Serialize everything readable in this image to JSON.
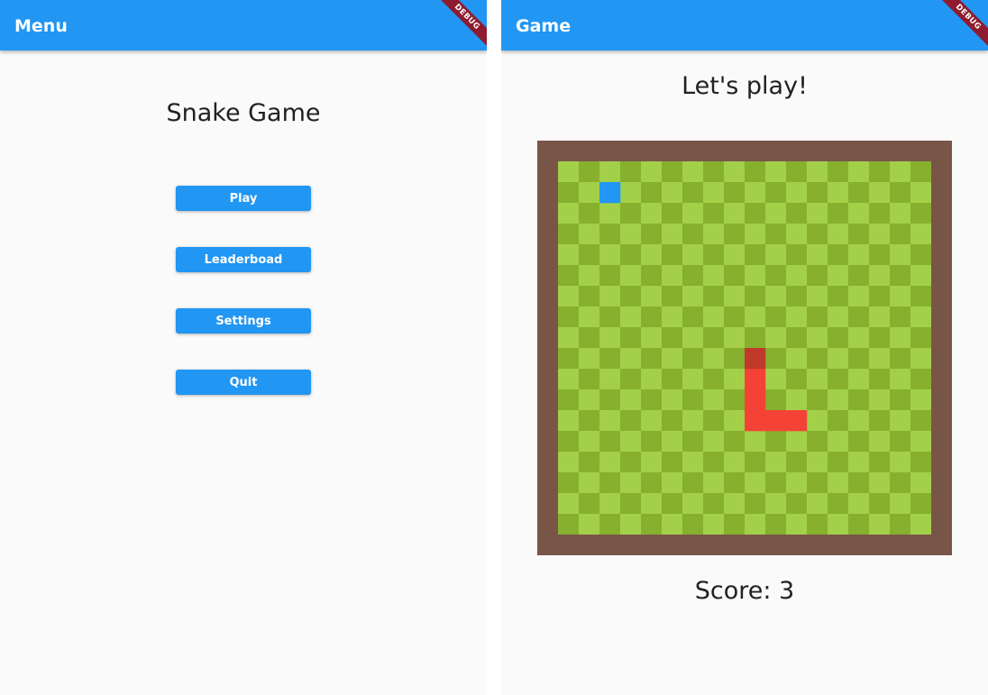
{
  "menu": {
    "appbar_title": "Menu",
    "debug_label": "DEBUG",
    "title": "Snake Game",
    "buttons": [
      {
        "label": "Play"
      },
      {
        "label": "Leaderboad"
      },
      {
        "label": "Settings"
      },
      {
        "label": "Quit"
      }
    ]
  },
  "game": {
    "appbar_title": "Game",
    "debug_label": "DEBUG",
    "title": "Let's play!",
    "score_text": "Score: 3",
    "board": {
      "columns": 18,
      "rows": 18,
      "colors": {
        "frame": "#795548",
        "grass_light": "#a2d149",
        "grass_dark": "#86b02e",
        "food": "#2196f3",
        "snake_head": "#c0392b",
        "snake_body": "#f44336"
      },
      "food": {
        "col": 2,
        "row": 1
      },
      "snake": {
        "head": {
          "col": 9,
          "row": 9
        },
        "body": [
          {
            "col": 9,
            "row": 10
          },
          {
            "col": 9,
            "row": 11
          },
          {
            "col": 9,
            "row": 12
          },
          {
            "col": 10,
            "row": 12
          },
          {
            "col": 11,
            "row": 12
          }
        ]
      }
    }
  }
}
